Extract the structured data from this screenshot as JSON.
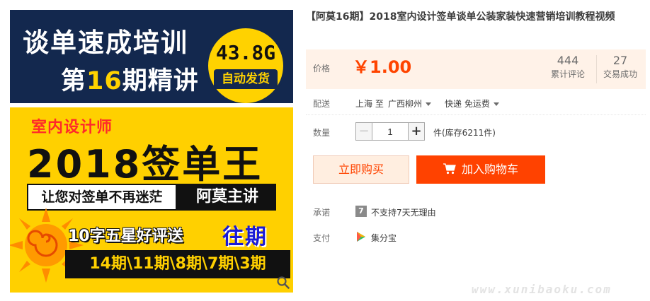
{
  "gallery": {
    "banner_top_line1": "谈单速成培训",
    "banner_top_line2_pre": "第",
    "banner_top_line2_num": "16",
    "banner_top_line2_post": "期精讲",
    "badge_size": "43.8G",
    "badge_auto": "自动发货",
    "designer": "室内设计师",
    "main_title": "2018签单王",
    "slogan_left": "让您对签单不再迷茫",
    "slogan_right": "阿莫主讲",
    "review_text": "10字五星好评送",
    "past_text": "往期",
    "issues_text": "14期\\11期\\8期\\7期\\3期"
  },
  "product": {
    "title": "【阿莫16期】2018室内设计签单谈单公装家装快速营销培训教程视频"
  },
  "price": {
    "label": "价格",
    "value": "￥1.00"
  },
  "stats": {
    "reviews_count": "444",
    "reviews_label": "累计评论",
    "deals_count": "27",
    "deals_label": "交易成功"
  },
  "delivery": {
    "label": "配送",
    "origin": "上海 至",
    "destination": "广西柳州",
    "method": "快递 免运费"
  },
  "quantity": {
    "label": "数量",
    "value": "1",
    "minus": "−",
    "plus": "+",
    "stock": "件(库存6211件)"
  },
  "buttons": {
    "buy_now": "立即购买",
    "add_cart": "加入购物车"
  },
  "promise": {
    "label": "承诺",
    "icon_text": "7",
    "text": "不支持7天无理由"
  },
  "payment": {
    "label": "支付",
    "text": "集分宝"
  },
  "watermark": "www.xunibaoku.com",
  "colors": {
    "accent": "#ff4400",
    "cart_button": "#ff4200",
    "price_bg": "#fff2e8",
    "banner_navy": "#13284e",
    "banner_yellow": "#ffd000"
  }
}
